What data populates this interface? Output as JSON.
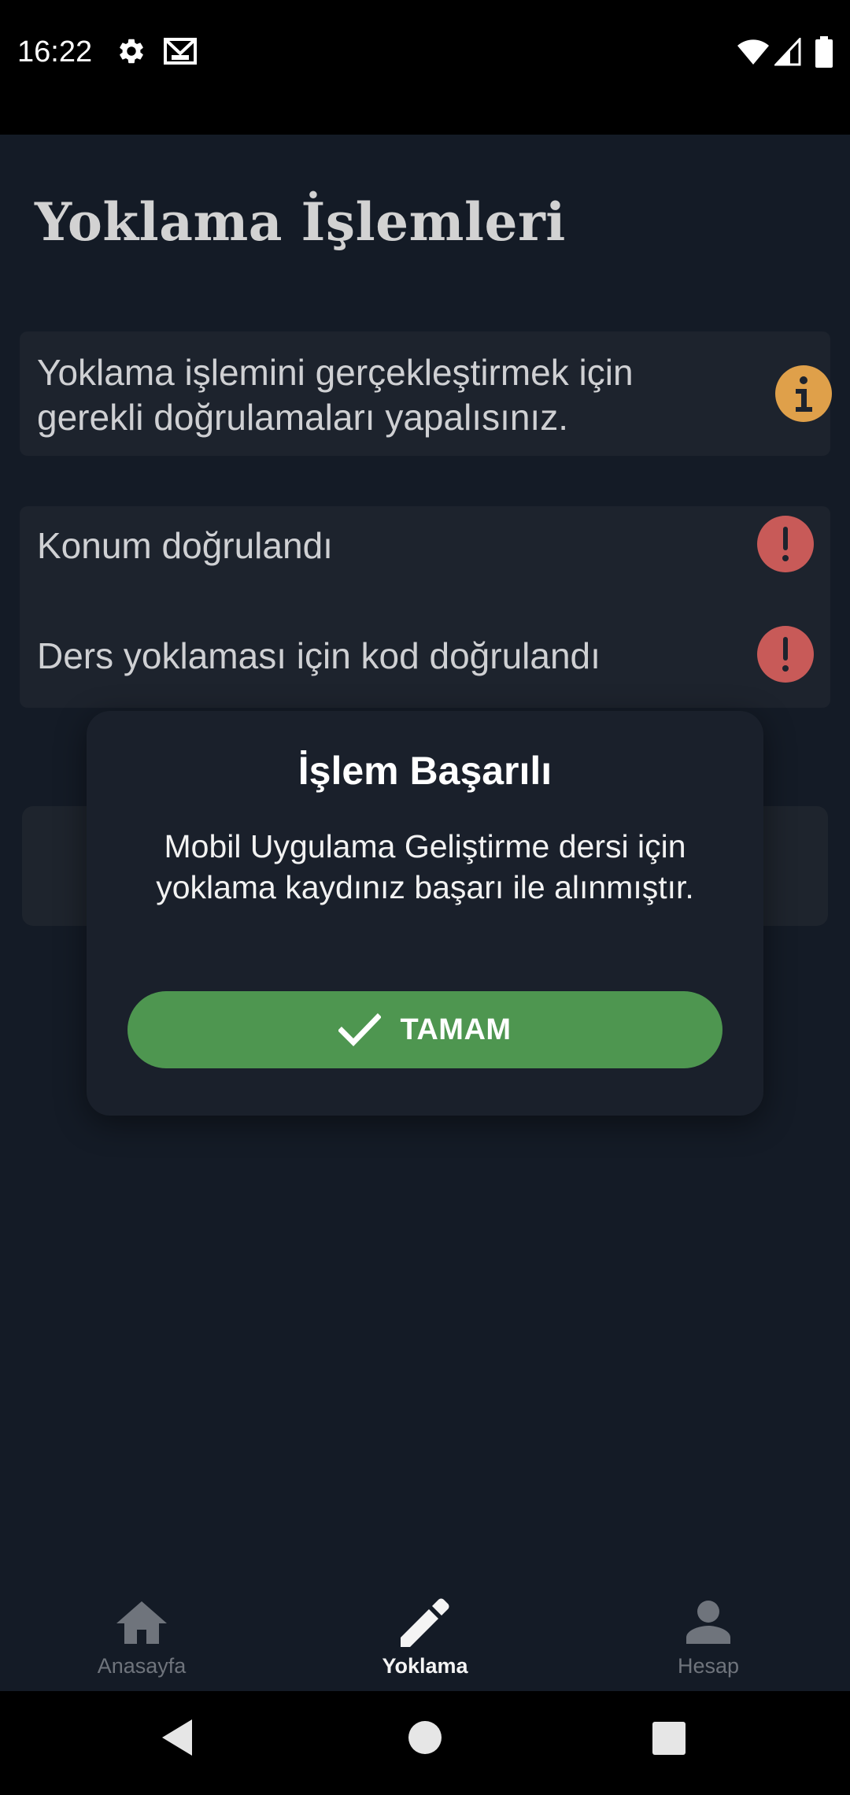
{
  "status_bar": {
    "time": "16:22",
    "icons_left": [
      "gear-icon",
      "mail-icon"
    ],
    "icons_right": [
      "wifi-icon",
      "signal-icon",
      "battery-icon"
    ]
  },
  "page": {
    "title": "Yoklama İşlemleri"
  },
  "info_card": {
    "text": "Yoklama işlemini gerçekleştirmek için gerekli doğrulamaları yapalısınız.",
    "icon": "info-icon",
    "icon_color": "#dfa04a"
  },
  "checks": [
    {
      "label": "Konum doğrulandı",
      "icon": "exclamation-icon",
      "status_color": "#c85a58"
    },
    {
      "label": "Ders yoklaması için kod doğrulandı",
      "icon": "exclamation-icon",
      "status_color": "#c85a58"
    }
  ],
  "dialog": {
    "title": "İşlem Başarılı",
    "message": "Mobil Uygulama Geliştirme dersi için yoklama kaydınız başarı ile alınmıştır.",
    "button_label": "TAMAM",
    "button_icon": "check-icon",
    "button_color": "#4e9650"
  },
  "bottom_nav": {
    "items": [
      {
        "label": "Anasayfa",
        "icon": "home-icon",
        "active": false
      },
      {
        "label": "Yoklama",
        "icon": "pencil-icon",
        "active": true
      },
      {
        "label": "Hesap",
        "icon": "person-icon",
        "active": false
      }
    ]
  },
  "system_nav": {
    "buttons": [
      "back-icon",
      "home-circle-icon",
      "recents-icon"
    ]
  }
}
